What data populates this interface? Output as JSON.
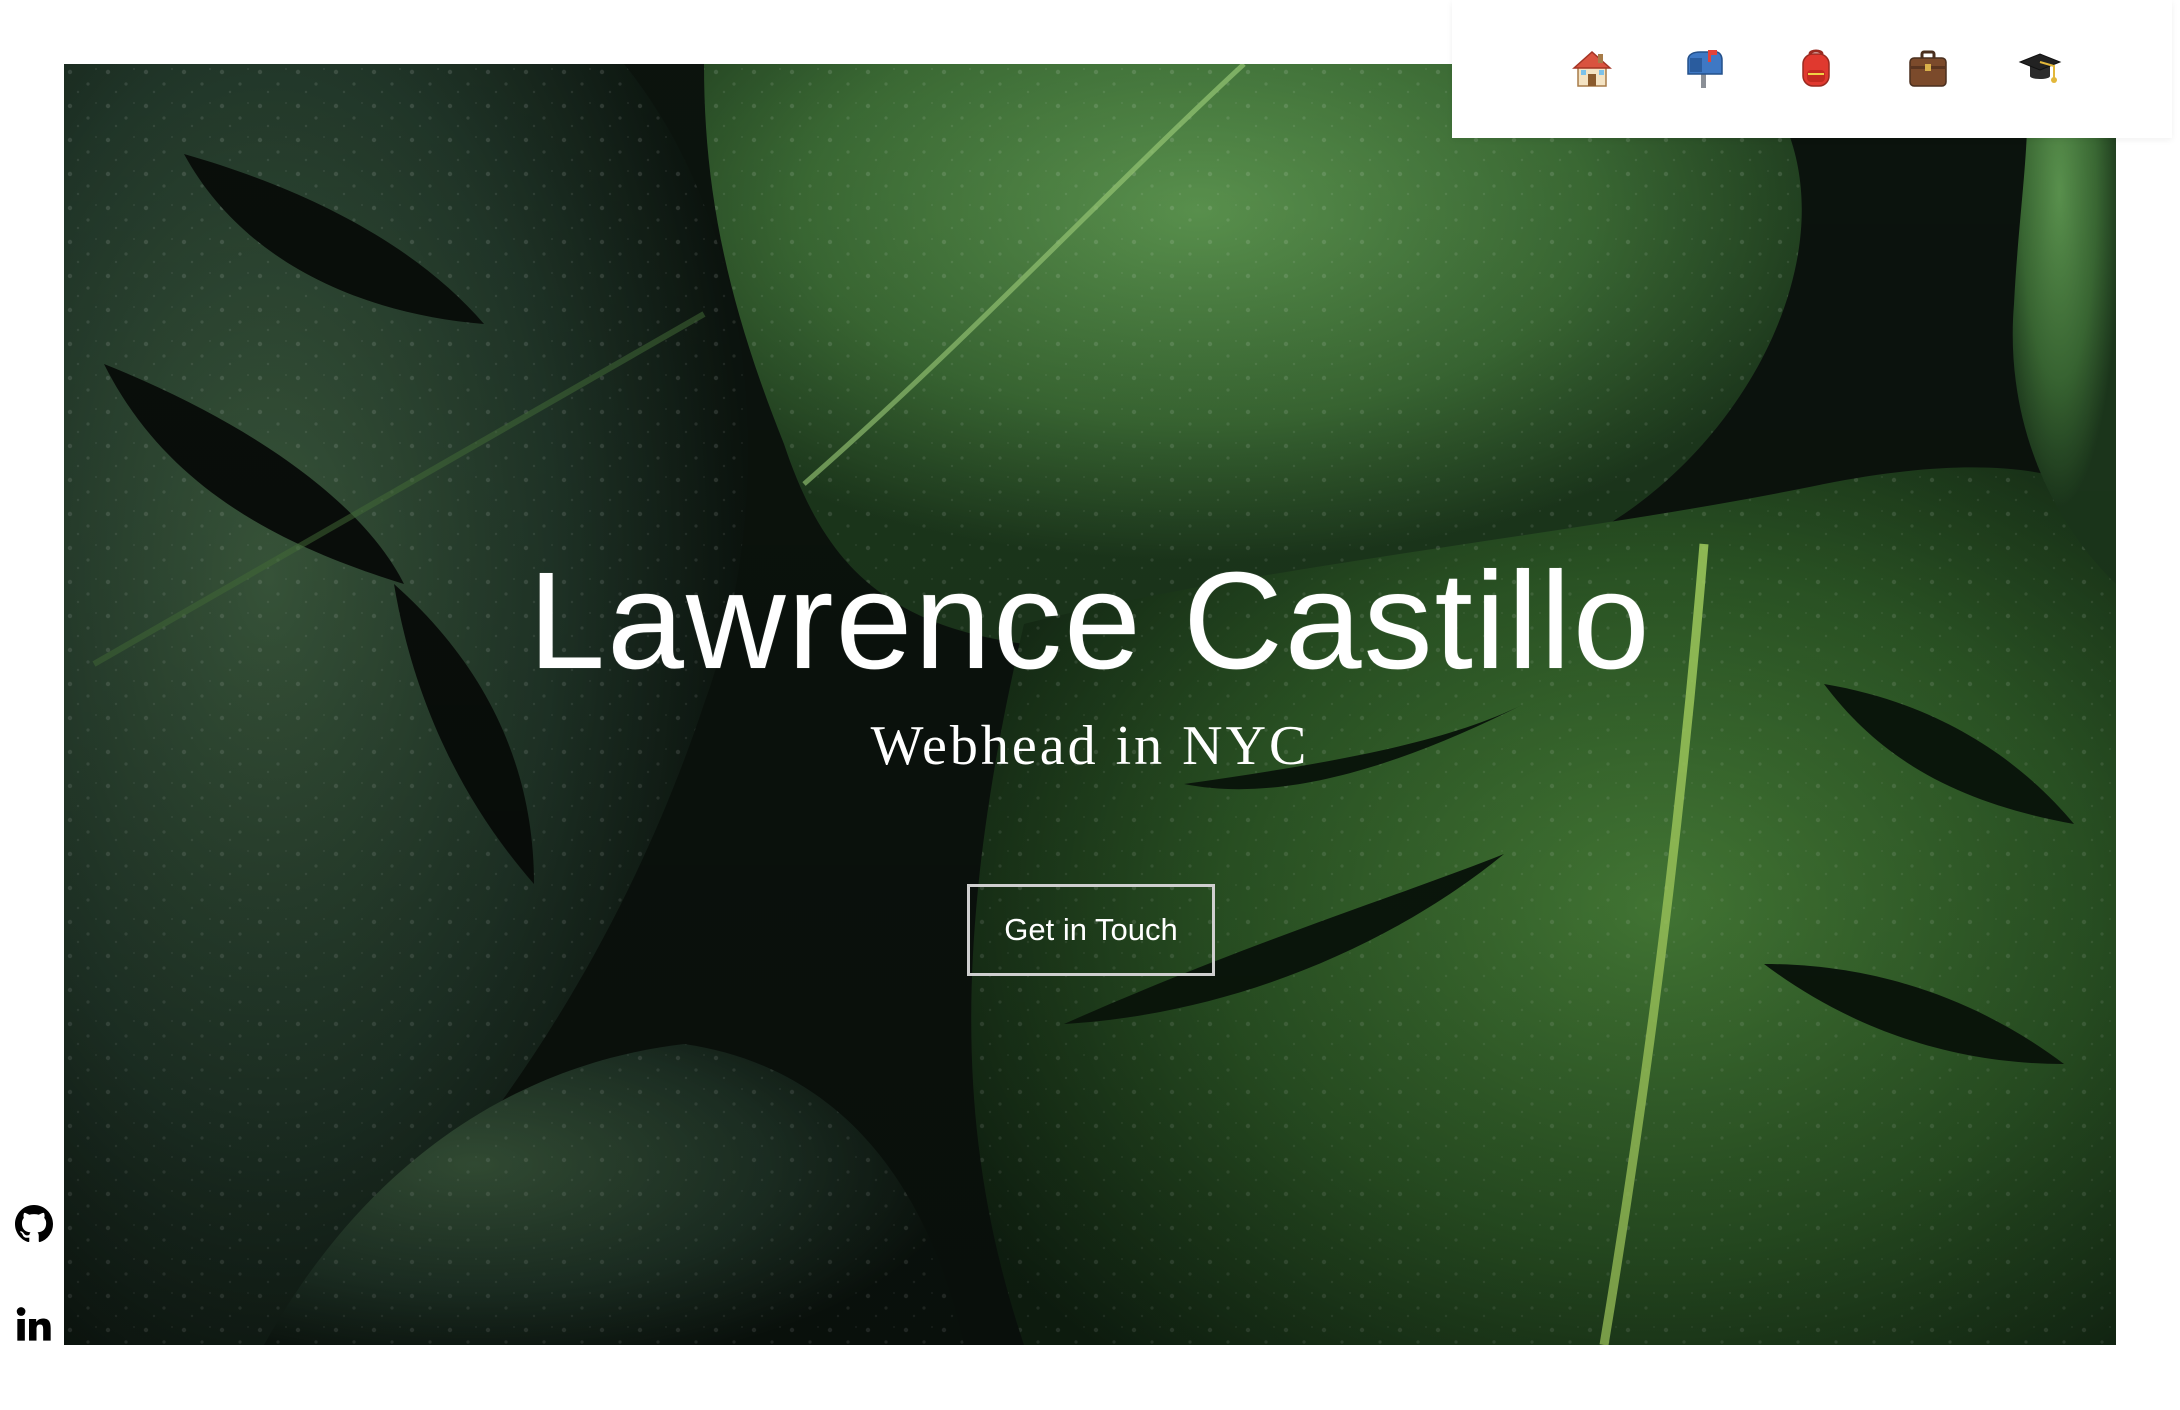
{
  "hero": {
    "title": "Lawrence Castillo",
    "subtitle": "Webhead in NYC",
    "cta_label": "Get in Touch"
  },
  "nav": {
    "items": [
      {
        "icon": "house-icon",
        "target": "home"
      },
      {
        "icon": "mailbox-icon",
        "target": "contact"
      },
      {
        "icon": "backpack-icon",
        "target": "about"
      },
      {
        "icon": "briefcase-icon",
        "target": "work"
      },
      {
        "icon": "graduation-cap-icon",
        "target": "education"
      }
    ]
  },
  "social": {
    "items": [
      {
        "icon": "github-icon"
      },
      {
        "icon": "linkedin-icon"
      }
    ]
  },
  "colors": {
    "background": "#ffffff",
    "text_on_hero": "#ffffff",
    "button_border": "#cfcfcf",
    "leaf_dark": "#1c3a1f",
    "leaf_bright": "#4f8f3a"
  }
}
